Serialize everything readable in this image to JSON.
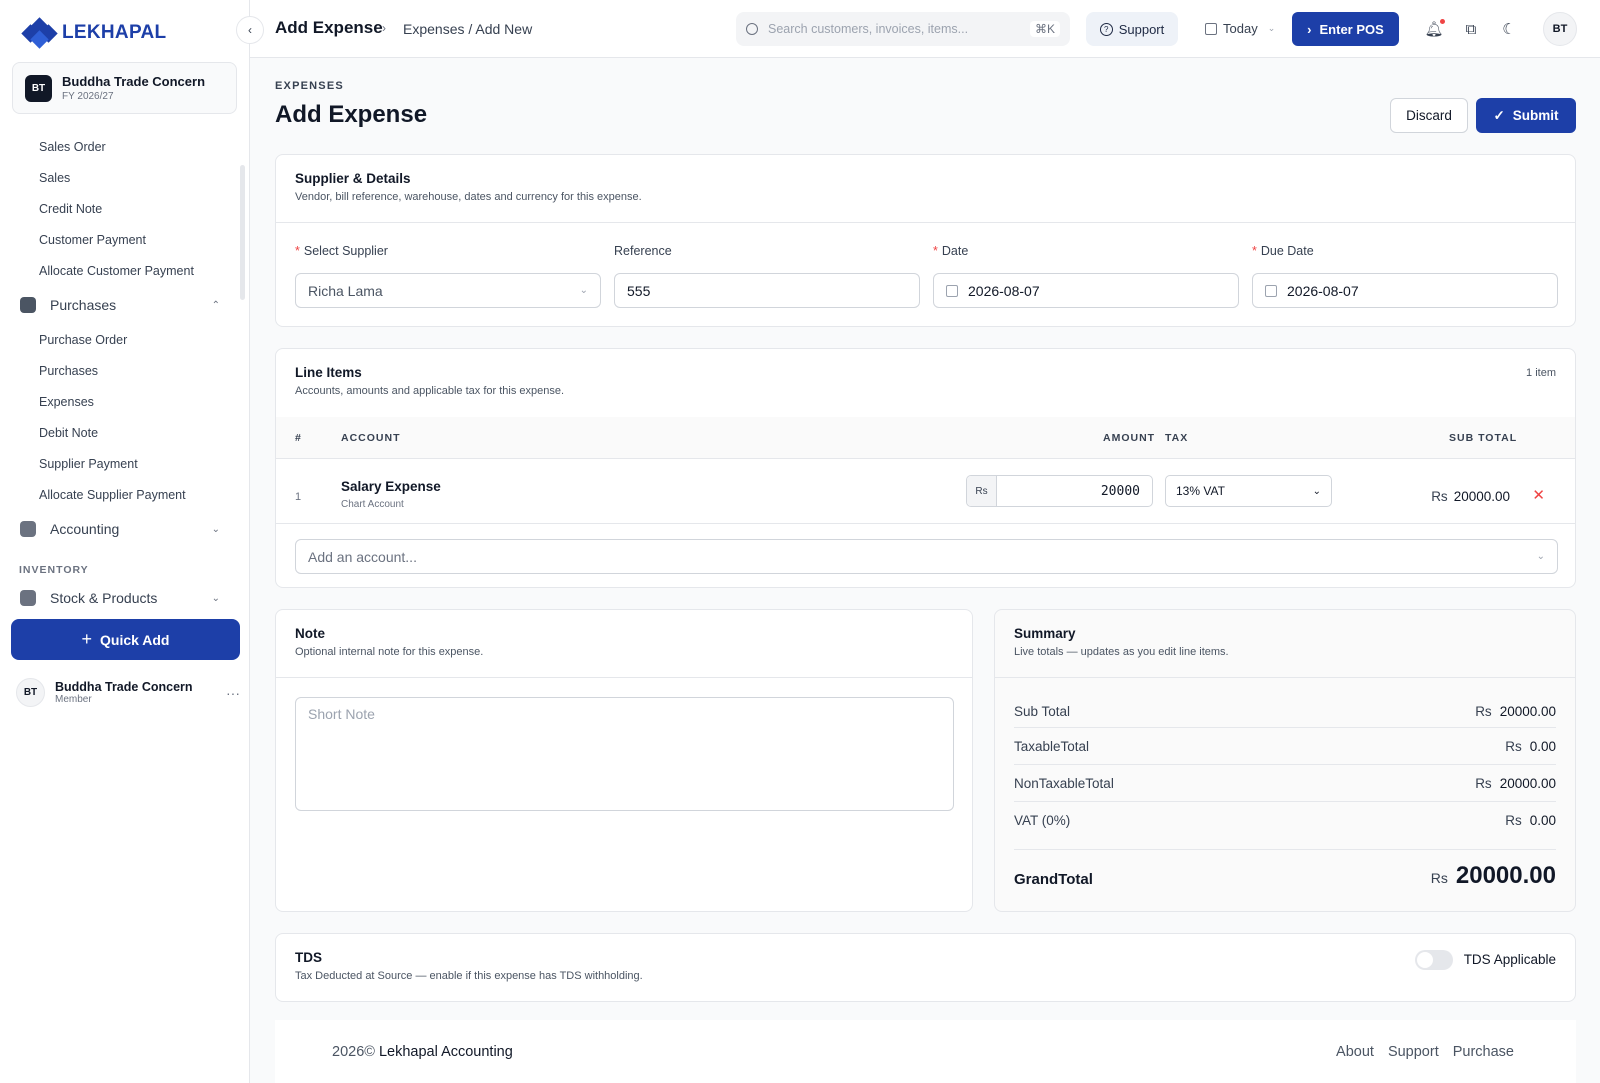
{
  "brand": {
    "name": "LEKHAPAL"
  },
  "org": {
    "initials": "BT",
    "name": "Buddha Trade Concern",
    "fy": "FY 2026/27"
  },
  "sidebar": {
    "sales_items": [
      "Sales Order",
      "Sales",
      "Credit Note",
      "Customer Payment",
      "Allocate Customer Payment"
    ],
    "purchases_label": "Purchases",
    "purchase_items": [
      "Purchase Order",
      "Purchases",
      "Expenses",
      "Debit Note",
      "Supplier Payment",
      "Allocate Supplier Payment"
    ],
    "accounting_label": "Accounting",
    "inventory_section": "INVENTORY",
    "stock_label": "Stock & Products",
    "quick_add": "Quick Add"
  },
  "user": {
    "initials": "BT",
    "name": "Buddha Trade Concern",
    "role": "Member"
  },
  "topbar": {
    "title": "Add Expense",
    "breadcrumb": "Expenses / Add New",
    "search_placeholder": "Search customers, invoices, items...",
    "search_shortcut": "⌘K",
    "support": "Support",
    "date_filter": "Today",
    "pos": "Enter POS",
    "avatar": "BT"
  },
  "page": {
    "eyebrow": "EXPENSES",
    "title": "Add Expense",
    "discard": "Discard",
    "submit": "Submit"
  },
  "supplier_card": {
    "title": "Supplier & Details",
    "subtitle": "Vendor, bill reference, warehouse, dates and currency for this expense.",
    "supplier_label": "Select Supplier",
    "supplier_value": "Richa Lama",
    "reference_label": "Reference",
    "reference_value": "555",
    "date_label": "Date",
    "date_value": "2026-08-07",
    "due_label": "Due Date",
    "due_value": "2026-08-07"
  },
  "line_items": {
    "title": "Line Items",
    "subtitle": "Accounts, amounts and applicable tax for this expense.",
    "count": "1 item",
    "headers": {
      "num": "#",
      "account": "ACCOUNT",
      "amount": "AMOUNT",
      "tax": "TAX",
      "subtotal": "SUB TOTAL"
    },
    "rows": [
      {
        "num": "1",
        "account": "Salary Expense",
        "type": "Chart Account",
        "currency": "Rs",
        "amount": "20000",
        "tax": "13% VAT",
        "subtotal_currency": "Rs",
        "subtotal": "20000.00"
      }
    ],
    "add_placeholder": "Add an account..."
  },
  "note_card": {
    "title": "Note",
    "subtitle": "Optional internal note for this expense.",
    "placeholder": "Short Note"
  },
  "summary": {
    "title": "Summary",
    "subtitle": "Live totals — updates as you edit line items.",
    "currency": "Rs",
    "rows": [
      {
        "label": "Sub Total",
        "value": "20000.00"
      },
      {
        "label": "TaxableTotal",
        "value": "0.00"
      },
      {
        "label": "NonTaxableTotal",
        "value": "20000.00"
      },
      {
        "label": "VAT (0%)",
        "value": "0.00"
      }
    ],
    "grand_label": "GrandTotal",
    "grand_value": "20000.00"
  },
  "tds": {
    "title": "TDS",
    "subtitle": "Tax Deducted at Source — enable if this expense has TDS withholding.",
    "toggle_label": "TDS Applicable",
    "enabled": false
  },
  "footer": {
    "year": "2026©",
    "company": "Lekhapal Accounting",
    "links": [
      "About",
      "Support",
      "Purchase"
    ]
  }
}
